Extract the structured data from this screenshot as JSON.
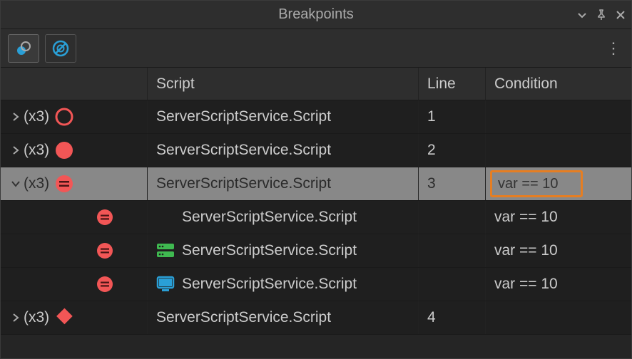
{
  "title": "Breakpoints",
  "columns": {
    "script": "Script",
    "line": "Line",
    "condition": "Condition"
  },
  "rows": [
    {
      "id": "r1",
      "expanded": false,
      "count": "(x3)",
      "bp_style": "outline-circle",
      "script": "ServerScriptService.Script",
      "line": "1",
      "condition": "",
      "selected": false,
      "child": false
    },
    {
      "id": "r2",
      "expanded": false,
      "count": "(x3)",
      "bp_style": "filled-circle",
      "script": "ServerScriptService.Script",
      "line": "2",
      "condition": "",
      "selected": false,
      "child": false
    },
    {
      "id": "r3",
      "expanded": true,
      "count": "(x3)",
      "bp_style": "cond-circle",
      "script": "ServerScriptService.Script",
      "line": "3",
      "condition_editing": "var == 10",
      "selected": true,
      "child": false
    },
    {
      "id": "r3a",
      "bp_style": "cond-circle",
      "context_icon": null,
      "script": "ServerScriptService.Script",
      "line": "",
      "condition": "var == 10",
      "child": true,
      "indent": 1
    },
    {
      "id": "r3b",
      "bp_style": "cond-circle",
      "context_icon": "server",
      "script": "ServerScriptService.Script",
      "line": "",
      "condition": "var == 10",
      "child": true,
      "indent": 1
    },
    {
      "id": "r3c",
      "bp_style": "cond-circle",
      "context_icon": "client",
      "script": "ServerScriptService.Script",
      "line": "",
      "condition": "var == 10",
      "child": true,
      "indent": 1
    },
    {
      "id": "r4",
      "expanded": false,
      "count": "(x3)",
      "bp_style": "diamond",
      "script": "ServerScriptService.Script",
      "line": "4",
      "condition": "",
      "selected": false,
      "child": false
    }
  ],
  "colors": {
    "red": "#f25656",
    "blue": "#2a9fd6",
    "green": "#3fb950",
    "highlight": "#e67e22"
  }
}
